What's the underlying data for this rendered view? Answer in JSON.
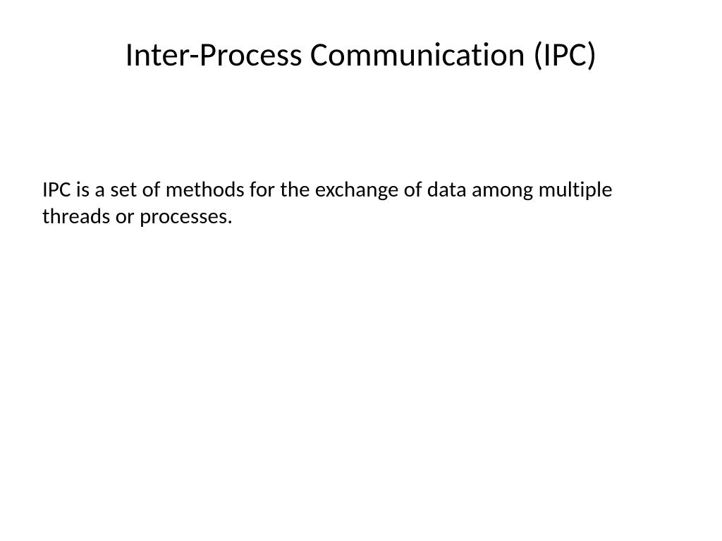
{
  "slide": {
    "title": "Inter-Process Communication (IPC)",
    "body": "IPC is a set of methods for the exchange of data among multiple threads or processes."
  }
}
